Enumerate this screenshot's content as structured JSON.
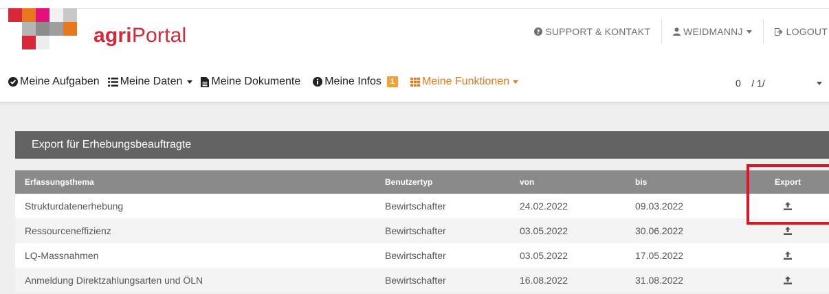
{
  "brand": {
    "bold": "agri",
    "regular": "Portal",
    "red": "#d9273a",
    "orange": "#e8771d",
    "gray": "#9a9a9a"
  },
  "topnav": {
    "support": {
      "icon": "question-circle-icon",
      "label": "SUPPORT & KONTAKT"
    },
    "user": {
      "icon": "user-icon",
      "label": "WEIDMANNJ"
    },
    "logout": {
      "icon": "sign-out-icon",
      "label": "LOGOUT"
    }
  },
  "mainnav": {
    "aufgaben": {
      "icon": "check-circle-icon",
      "label": "Meine Aufgaben"
    },
    "daten": {
      "icon": "list-icon",
      "label": "Meine Daten"
    },
    "dokumente": {
      "icon": "file-icon",
      "label": "Meine Dokumente"
    },
    "infos": {
      "icon": "info-circle-icon",
      "label": "Meine Infos",
      "badge": "1"
    },
    "funktionen": {
      "icon": "grid-icon",
      "label": "Meine Funktionen"
    }
  },
  "selector": {
    "value": "0    / 1/"
  },
  "panel": {
    "title": "Export für Erhebungsbeauftragte"
  },
  "table": {
    "headers": {
      "thema": "Erfassungsthema",
      "typ": "Benutzertyp",
      "von": "von",
      "bis": "bis",
      "export": "Export"
    },
    "rows": [
      {
        "thema": "Strukturdatenerhebung",
        "typ": "Bewirtschafter",
        "von": "24.02.2022",
        "bis": "09.03.2022"
      },
      {
        "thema": "Ressourceneffizienz",
        "typ": "Bewirtschafter",
        "von": "03.05.2022",
        "bis": "30.06.2022"
      },
      {
        "thema": "LQ-Massnahmen",
        "typ": "Bewirtschafter",
        "von": "03.05.2022",
        "bis": "17.05.2022"
      },
      {
        "thema": "Anmeldung Direktzahlungsarten und ÖLN",
        "typ": "Bewirtschafter",
        "von": "16.08.2022",
        "bis": "31.08.2022"
      }
    ]
  },
  "colors": {
    "highlight": "#e8101e",
    "panel_header": "#636363",
    "table_header": "#8a8a8a",
    "badge": "#f0a33a"
  }
}
